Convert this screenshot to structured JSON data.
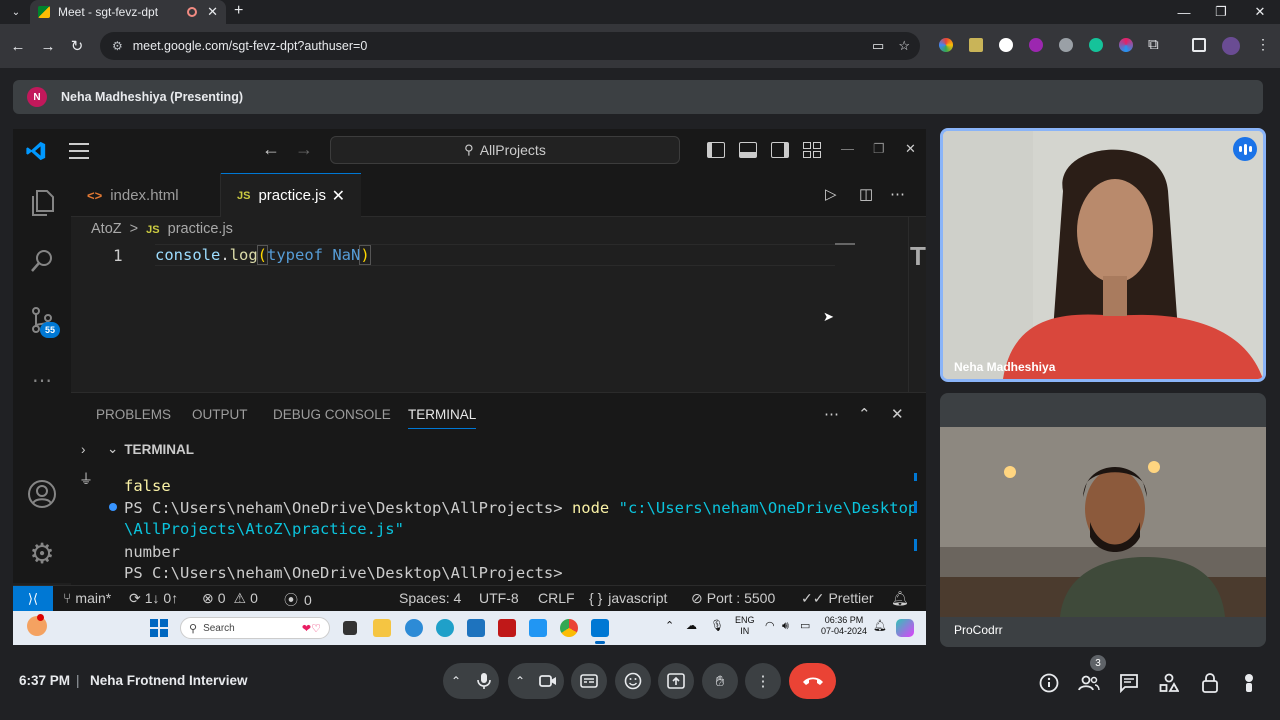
{
  "browser": {
    "tab_title": "Meet - sgt-fevz-dpt",
    "url": "meet.google.com/sgt-fevz-dpt?authuser=0",
    "new_tab": "+",
    "tab_close": "✕",
    "minimize": "—",
    "maximize": "❐",
    "close": "✕"
  },
  "presenting": {
    "avatar_letter": "N",
    "label": "Neha Madheshiya (Presenting)"
  },
  "vscode": {
    "command_center": "AllProjects",
    "tabs": [
      {
        "label": "index.html",
        "icon": "html-file-icon",
        "glyph": "<>"
      },
      {
        "label": "practice.js",
        "icon": "js-file-icon",
        "glyph": "JS"
      }
    ],
    "breadcrumb": {
      "folder": "AtoZ",
      "sep": ">",
      "glyph": "JS",
      "file": "practice.js"
    },
    "editor": {
      "line_number": "1",
      "code_fn_obj": "console",
      "code_dot": ".",
      "code_fn": "log",
      "code_open": "(",
      "code_kw": "typeof",
      "code_val": " NaN",
      "code_close": ")"
    },
    "scm_badge": "55",
    "panel": {
      "tabs": [
        "PROBLEMS",
        "OUTPUT",
        "DEBUG CONSOLE",
        "TERMINAL"
      ],
      "active_tab": "TERMINAL",
      "terminal_header": "TERMINAL",
      "lines": {
        "l1": "false",
        "l2_prompt": "PS C:\\Users\\neham\\OneDrive\\Desktop\\AllProjects> ",
        "l2_cmd": "node ",
        "l2_arg": "\"c:\\Users\\neham\\OneDrive\\Desktop",
        "l3_arg": "\\AllProjects\\AtoZ\\practice.js\"",
        "l4": "number",
        "l5": "PS C:\\Users\\neham\\OneDrive\\Desktop\\AllProjects>"
      }
    },
    "statusbar": {
      "branch": "main*",
      "sync": "1↓ 0↑",
      "errors": "0",
      "warnings": "0",
      "ports": "0",
      "spaces": "Spaces: 4",
      "encoding": "UTF-8",
      "eol": "CRLF",
      "language": "javascript",
      "port": "Port : 5500",
      "formatter": "Prettier"
    }
  },
  "taskbar": {
    "search": "Search",
    "lang_line1": "ENG",
    "lang_line2": "IN",
    "time": "06:36 PM",
    "date": "07-04-2024"
  },
  "participants": [
    {
      "name": "Neha Madheshiya",
      "speaking": true
    },
    {
      "name": "ProCodrr"
    }
  ],
  "meeting": {
    "time": "6:37 PM",
    "separator": "|",
    "name": "Neha Frotnend Interview",
    "people_count": "3"
  },
  "colors": {
    "vscode_accent": "#0078d4",
    "meet_end_call": "#ea4335",
    "active_speaker_border": "#8ab4f8"
  }
}
